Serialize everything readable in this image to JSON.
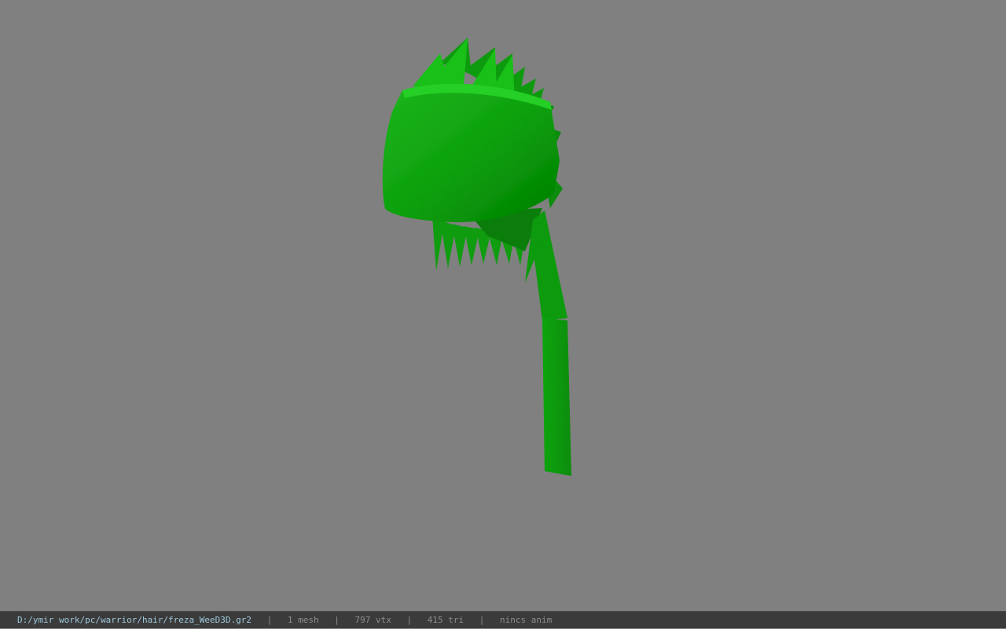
{
  "viewport": {
    "background_color": "#808080",
    "model_color": "#14b514"
  },
  "status_bar": {
    "file_path": "D:/ymir work/pc/warrior/hair/freza_WeeD3D.gr2",
    "separator": "|",
    "mesh_count": "1 mesh",
    "vertex_count": "797 vtx",
    "triangle_count": "415 tri",
    "animation": "nincs anim"
  }
}
